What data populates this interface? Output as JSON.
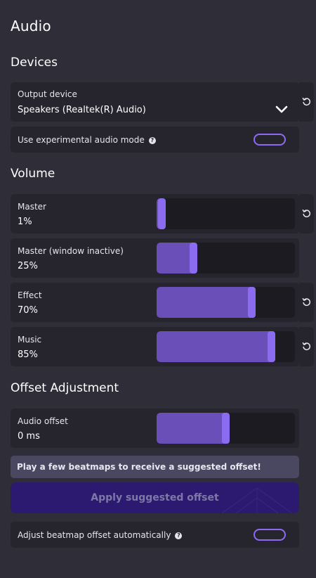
{
  "page": {
    "title": "Audio"
  },
  "devices": {
    "section_title": "Devices",
    "output_device": {
      "label": "Output device",
      "value": "Speakers (Realtek(R) Audio)"
    },
    "experimental_mode": {
      "label": "Use experimental audio mode",
      "enabled": false
    }
  },
  "volume": {
    "section_title": "Volume",
    "master": {
      "label": "Master",
      "value_text": "1%",
      "value": 0.01
    },
    "master_inactive": {
      "label": "Master (window inactive)",
      "value_text": "25%",
      "value": 0.25
    },
    "effect": {
      "label": "Effect",
      "value_text": "70%",
      "value": 0.7
    },
    "music": {
      "label": "Music",
      "value_text": "85%",
      "value": 0.85
    }
  },
  "offset": {
    "section_title": "Offset Adjustment",
    "audio_offset": {
      "label": "Audio offset",
      "value_text": "0 ms",
      "value": 0.5
    },
    "notice": "Play a few beatmaps to receive a suggested offset!",
    "apply_button": "Apply suggested offset",
    "auto_adjust": {
      "label": "Adjust beatmap offset automatically",
      "enabled": false
    }
  },
  "colors": {
    "background": "#2e2d38",
    "card": "#26252e",
    "accent": "#8b6cf0",
    "slider_fill": "#6a4fb8",
    "button": "#2b1a70"
  },
  "icons": {
    "dropdown": "chevron-down-icon",
    "revert": "revert-icon",
    "help": "help-circle-icon"
  }
}
